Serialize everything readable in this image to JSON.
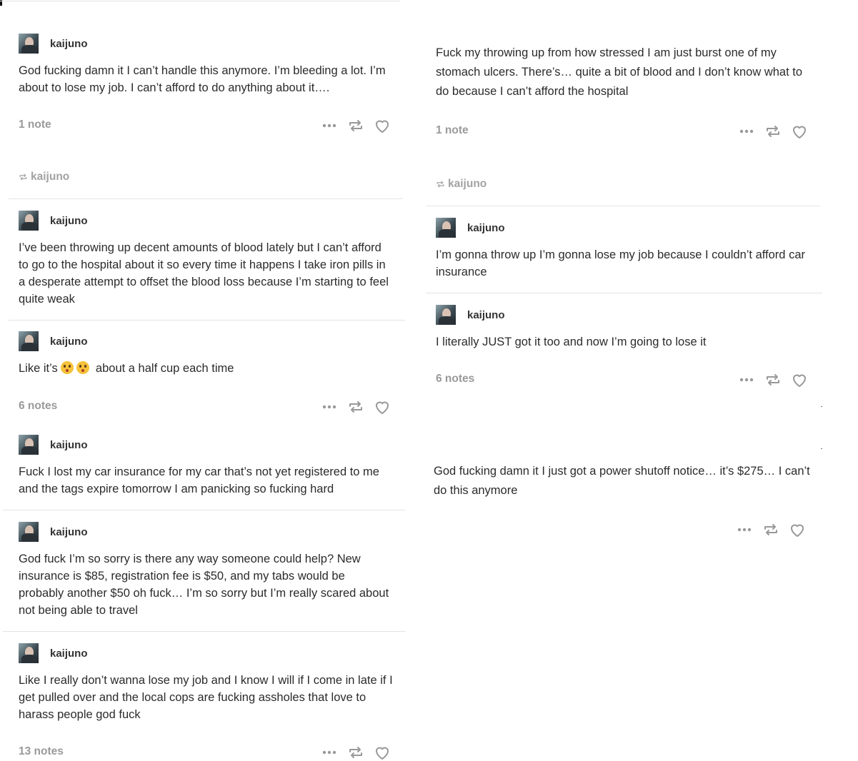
{
  "user": "kaijuno",
  "reblog_label": "kaijuno",
  "left": {
    "p1_text": "God fucking damn it I can’t handle this anymore. I’m bleeding a lot. I’m about to lose my job. I can’t afford to do anything about it….",
    "p1_notes": "1 note",
    "p2_text": "I’ve been throwing up decent amounts of blood lately but I can’t afford to go to the hospital about it so every time it happens I take iron pills in a desperate attempt to offset the blood loss because I’m starting to feel quite weak",
    "p3_text_a": "Like it’s",
    "p3_text_b": "about a half cup each time",
    "p3_notes": "6 notes",
    "p4_text": "Fuck I lost my car insurance for my car that’s not yet registered to me and the tags expire tomorrow I am panicking so fucking hard",
    "p5_text": "God fuck I’m so sorry is there any way someone could help? New insurance is $85, registration fee is $50, and my tabs would be probably another $50 oh fuck… I’m so sorry but I’m really scared about not being able to travel",
    "p6_text": "Like I really don’t wanna lose my job and I know I will if I come in late if I get pulled over and the local cops are fucking assholes that love to harass people god fuck",
    "p6_notes": "13 notes"
  },
  "right": {
    "r1_text": "Fuck my throwing up from how stressed I am just burst one of my stomach ulcers. There’s… quite a bit of blood and I don’t know what to do because I can’t afford the hospital",
    "r1_notes": "1 note",
    "r2_text": "I’m gonna throw up I’m gonna lose my job because I couldn’t afford car insurance",
    "r3_text": "I literally JUST got it too and now I’m going to lose it",
    "r3_notes": "6 notes",
    "r4_text": "God fucking damn it I just got a power shutoff notice… it’s $275… I can’t do this anymore"
  },
  "icons": {
    "more": "more-dots-icon",
    "reblog": "reblog-icon",
    "like": "heart-icon",
    "emoji": "flushed-face-emoji"
  }
}
